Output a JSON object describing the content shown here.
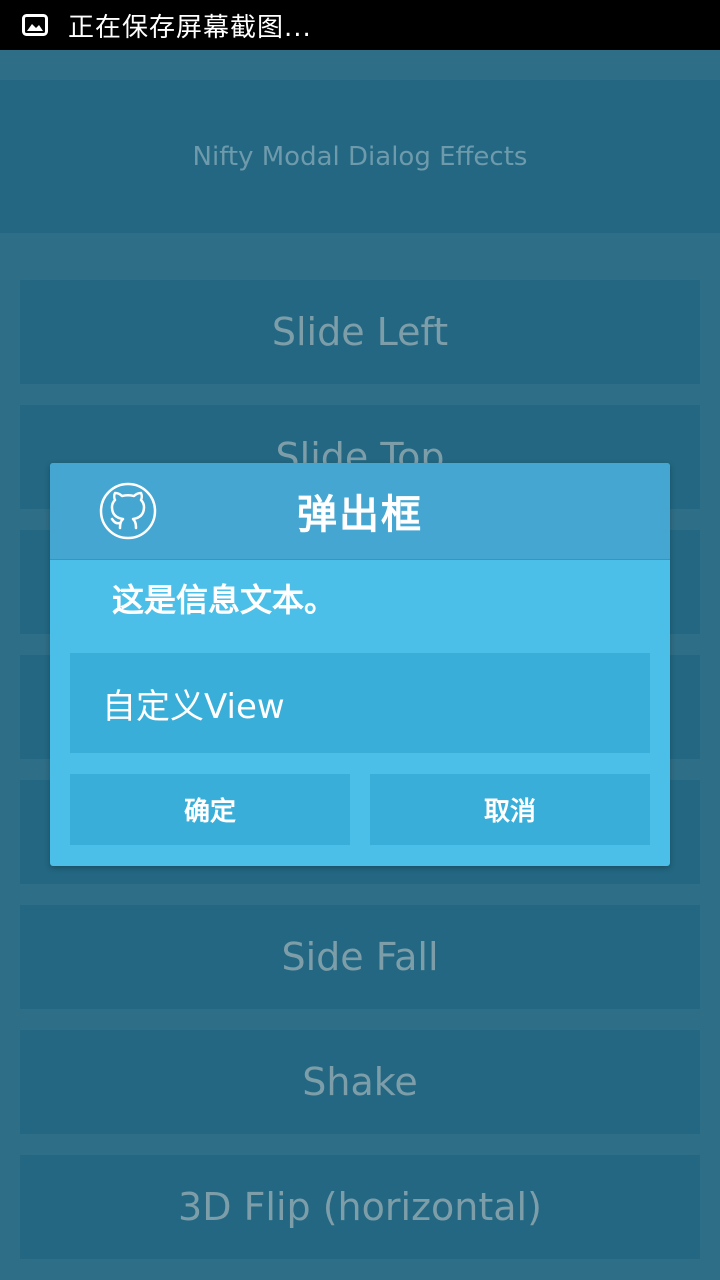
{
  "status_bar": {
    "text": "正在保存屏幕截图...",
    "icon": "image-icon"
  },
  "header": {
    "title": "Nifty Modal Dialog Effects"
  },
  "list": {
    "items": [
      "Slide Left",
      "Slide Top",
      "",
      "",
      "",
      "Side Fall",
      "Shake",
      "3D Flip (horizontal)"
    ]
  },
  "dialog": {
    "icon": "github-icon",
    "title": "弹出框",
    "message": "这是信息文本。",
    "custom_view": "自定义View",
    "ok_label": "确定",
    "cancel_label": "取消"
  },
  "colors": {
    "background": "#2f6e87",
    "button": "#236782",
    "dialog": "#4cbfe8",
    "dialog_header": "#44a6d1",
    "dialog_button": "#39aed9"
  }
}
